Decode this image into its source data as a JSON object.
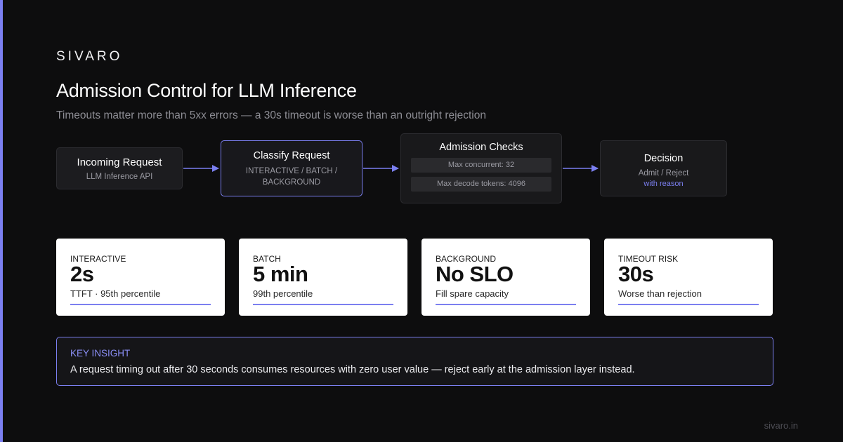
{
  "brand": "SIVARO",
  "title": "Admission Control for LLM Inference",
  "subtitle": "Timeouts matter more than 5xx errors — a 30s timeout is worse than an outright rejection",
  "flow": {
    "incoming": {
      "title": "Incoming Request",
      "subtitle": "LLM Inference API"
    },
    "classify": {
      "title": "Classify Request",
      "subtitle": "INTERACTIVE / BATCH / BACKGROUND"
    },
    "checks": {
      "title": "Admission Checks",
      "items": [
        "Max concurrent: 32",
        "Max decode tokens: 4096"
      ]
    },
    "decision": {
      "title": "Decision",
      "subtitle": "Admit / Reject",
      "note": "with reason"
    }
  },
  "cards": [
    {
      "label": "INTERACTIVE",
      "value": "2s",
      "description": "TTFT · 95th percentile"
    },
    {
      "label": "BATCH",
      "value": "5 min",
      "description": "99th percentile"
    },
    {
      "label": "BACKGROUND",
      "value": "No SLO",
      "description": "Fill spare capacity"
    },
    {
      "label": "TIMEOUT RISK",
      "value": "30s",
      "description": "Worse than rejection"
    }
  ],
  "insight": {
    "heading": "KEY INSIGHT",
    "body": "A request timing out after 30 seconds consumes resources with zero user value — reject early at the admission layer instead."
  },
  "footer": {
    "url": "sivaro.in"
  },
  "colors": {
    "accent": "#7b7ff0",
    "background": "#0d0d0e",
    "card": "#ffffff"
  }
}
